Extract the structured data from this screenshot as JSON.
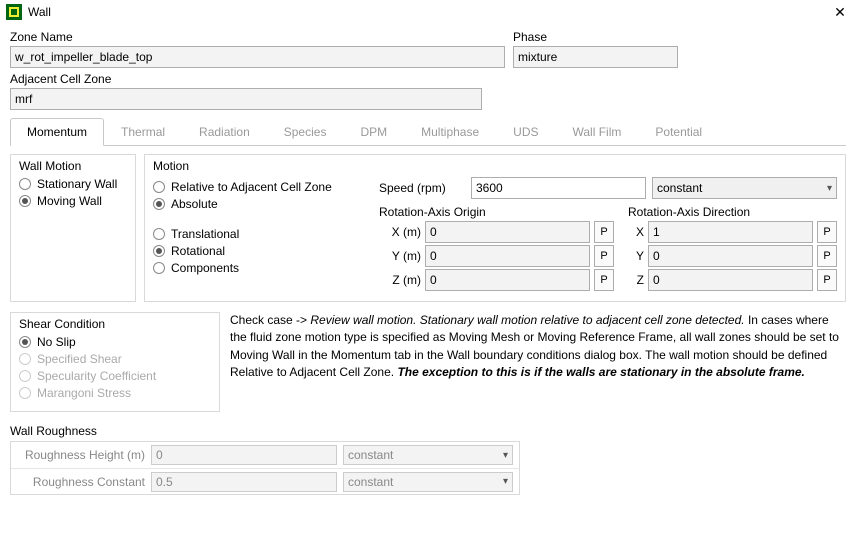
{
  "window": {
    "title": "Wall"
  },
  "fields": {
    "zoneName": {
      "label": "Zone Name",
      "value": "w_rot_impeller_blade_top"
    },
    "phase": {
      "label": "Phase",
      "value": "mixture"
    },
    "adjZone": {
      "label": "Adjacent Cell Zone",
      "value": "mrf"
    }
  },
  "tabs": [
    "Momentum",
    "Thermal",
    "Radiation",
    "Species",
    "DPM",
    "Multiphase",
    "UDS",
    "Wall Film",
    "Potential"
  ],
  "wallMotion": {
    "title": "Wall Motion",
    "options": [
      "Stationary Wall",
      "Moving Wall"
    ],
    "selected": 1
  },
  "motion": {
    "title": "Motion",
    "ref": {
      "options": [
        "Relative to Adjacent Cell Zone",
        "Absolute"
      ],
      "selected": 1
    },
    "type": {
      "options": [
        "Translational",
        "Rotational",
        "Components"
      ],
      "selected": 1
    },
    "speed": {
      "label": "Speed (rpm)",
      "value": "3600",
      "mode": "constant"
    },
    "origin": {
      "title": "Rotation-Axis Origin",
      "x": {
        "label": "X (m)",
        "value": "0"
      },
      "y": {
        "label": "Y (m)",
        "value": "0"
      },
      "z": {
        "label": "Z (m)",
        "value": "0"
      }
    },
    "direction": {
      "title": "Rotation-Axis Direction",
      "x": {
        "label": "X",
        "value": "1"
      },
      "y": {
        "label": "Y",
        "value": "0"
      },
      "z": {
        "label": "Z",
        "value": "0"
      }
    },
    "pBtn": "P"
  },
  "shear": {
    "title": "Shear Condition",
    "options": [
      "No Slip",
      "Specified Shear",
      "Specularity Coefficient",
      "Marangoni Stress"
    ],
    "selected": 0
  },
  "note": {
    "lead": "Check case   ->  ",
    "italic": "Review wall motion. Stationary wall motion relative to adjacent cell zone detected.",
    "body1": " In cases where the fluid zone motion type is specified as Moving Mesh or Moving Reference Frame, all wall zones should be set to Moving Wall in the Momentum tab in the Wall boundary conditions dialog box. The wall motion should be defined Relative to Adjacent Cell Zone. ",
    "bold": "The exception to this is if the walls are stationary in the absolute frame."
  },
  "roughness": {
    "title": "Wall Roughness",
    "height": {
      "label": "Roughness Height (m)",
      "value": "0",
      "mode": "constant"
    },
    "constant": {
      "label": "Roughness Constant",
      "value": "0.5",
      "mode": "constant"
    }
  }
}
